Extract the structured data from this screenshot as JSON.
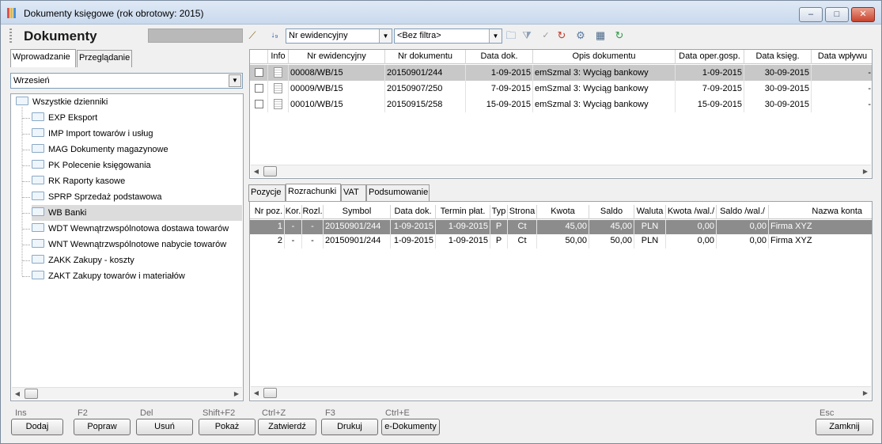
{
  "window": {
    "title": "Dokumenty księgowe (rok obrotowy: 2015)",
    "minimize": "‒",
    "maximize": "□",
    "close": "✕"
  },
  "toolbar": {
    "title": "Dokumenty",
    "sort_combo": "Nr ewidencyjny",
    "filter_combo": "<Bez filtra>"
  },
  "left_tabs": [
    "Wprowadzanie",
    "Przeglądanie"
  ],
  "month": "Wrzesień",
  "tree": {
    "root": "Wszystkie dzienniki",
    "items": [
      "EXP Eksport",
      "IMP Import towarów i usług",
      "MAG Dokumenty magazynowe",
      "PK Polecenie księgowania",
      "RK Raporty kasowe",
      "SPRP Sprzedaż podstawowa",
      "WB Banki",
      "WDT Wewnątrzwspólnotowa dostawa towarów",
      "WNT Wewnątrzwspólnotowe nabycie towarów",
      "ZAKK Zakupy - koszty",
      "ZAKT Zakupy towarów i materiałów"
    ],
    "selected_index": 6
  },
  "documents": {
    "columns": [
      "Info",
      "Nr ewidencyjny",
      "Nr dokumentu",
      "Data dok.",
      "Opis dokumentu",
      "Data oper.gosp.",
      "Data księg.",
      "Data wpływu"
    ],
    "rows": [
      {
        "nr_ew": "00008/WB/15",
        "nr_dok": "20150901/244",
        "data_dok": "1-09-2015",
        "opis": "emSzmal 3: Wyciąg bankowy",
        "data_oper": "1-09-2015",
        "data_ksieg": "30-09-2015",
        "data_wplywu": "-"
      },
      {
        "nr_ew": "00009/WB/15",
        "nr_dok": "20150907/250",
        "data_dok": "7-09-2015",
        "opis": "emSzmal 3: Wyciąg bankowy",
        "data_oper": "7-09-2015",
        "data_ksieg": "30-09-2015",
        "data_wplywu": "-"
      },
      {
        "nr_ew": "00010/WB/15",
        "nr_dok": "20150915/258",
        "data_dok": "15-09-2015",
        "opis": "emSzmal 3: Wyciąg bankowy",
        "data_oper": "15-09-2015",
        "data_ksieg": "30-09-2015",
        "data_wplywu": "-"
      }
    ]
  },
  "detail_tabs": [
    "Pozycje",
    "Rozrachunki",
    "VAT",
    "Podsumowanie"
  ],
  "settlements": {
    "columns": [
      "Nr poz.",
      "Kor.",
      "Rozl.",
      "Symbol",
      "Data dok.",
      "Termin płat.",
      "Typ",
      "Strona",
      "Kwota",
      "Saldo",
      "Waluta",
      "Kwota /wal./",
      "Saldo /wal./",
      "Nazwa konta"
    ],
    "rows": [
      {
        "nr": "1",
        "kor": "-",
        "rozl": "-",
        "symbol": "20150901/244",
        "data": "1-09-2015",
        "termin": "1-09-2015",
        "typ": "P",
        "strona": "Ct",
        "kwota": "45,00",
        "saldo": "45,00",
        "waluta": "PLN",
        "kwota_wal": "0,00",
        "saldo_wal": "0,00",
        "nazwa": "Firma XYZ"
      },
      {
        "nr": "2",
        "kor": "-",
        "rozl": "-",
        "symbol": "20150901/244",
        "data": "1-09-2015",
        "termin": "1-09-2015",
        "typ": "P",
        "strona": "Ct",
        "kwota": "50,00",
        "saldo": "50,00",
        "waluta": "PLN",
        "kwota_wal": "0,00",
        "saldo_wal": "0,00",
        "nazwa": "Firma XYZ"
      }
    ]
  },
  "buttons": [
    {
      "shortcut": "Ins",
      "label": "Dodaj"
    },
    {
      "shortcut": "F2",
      "label": "Popraw"
    },
    {
      "shortcut": "Del",
      "label": "Usuń"
    },
    {
      "shortcut": "Shift+F2",
      "label": "Pokaż"
    },
    {
      "shortcut": "Ctrl+Z",
      "label": "Zatwierdź"
    },
    {
      "shortcut": "F3",
      "label": "Drukuj"
    },
    {
      "shortcut": "Ctrl+E",
      "label": "e-Dokumenty"
    },
    {
      "shortcut": "Esc",
      "label": "Zamknij"
    }
  ]
}
